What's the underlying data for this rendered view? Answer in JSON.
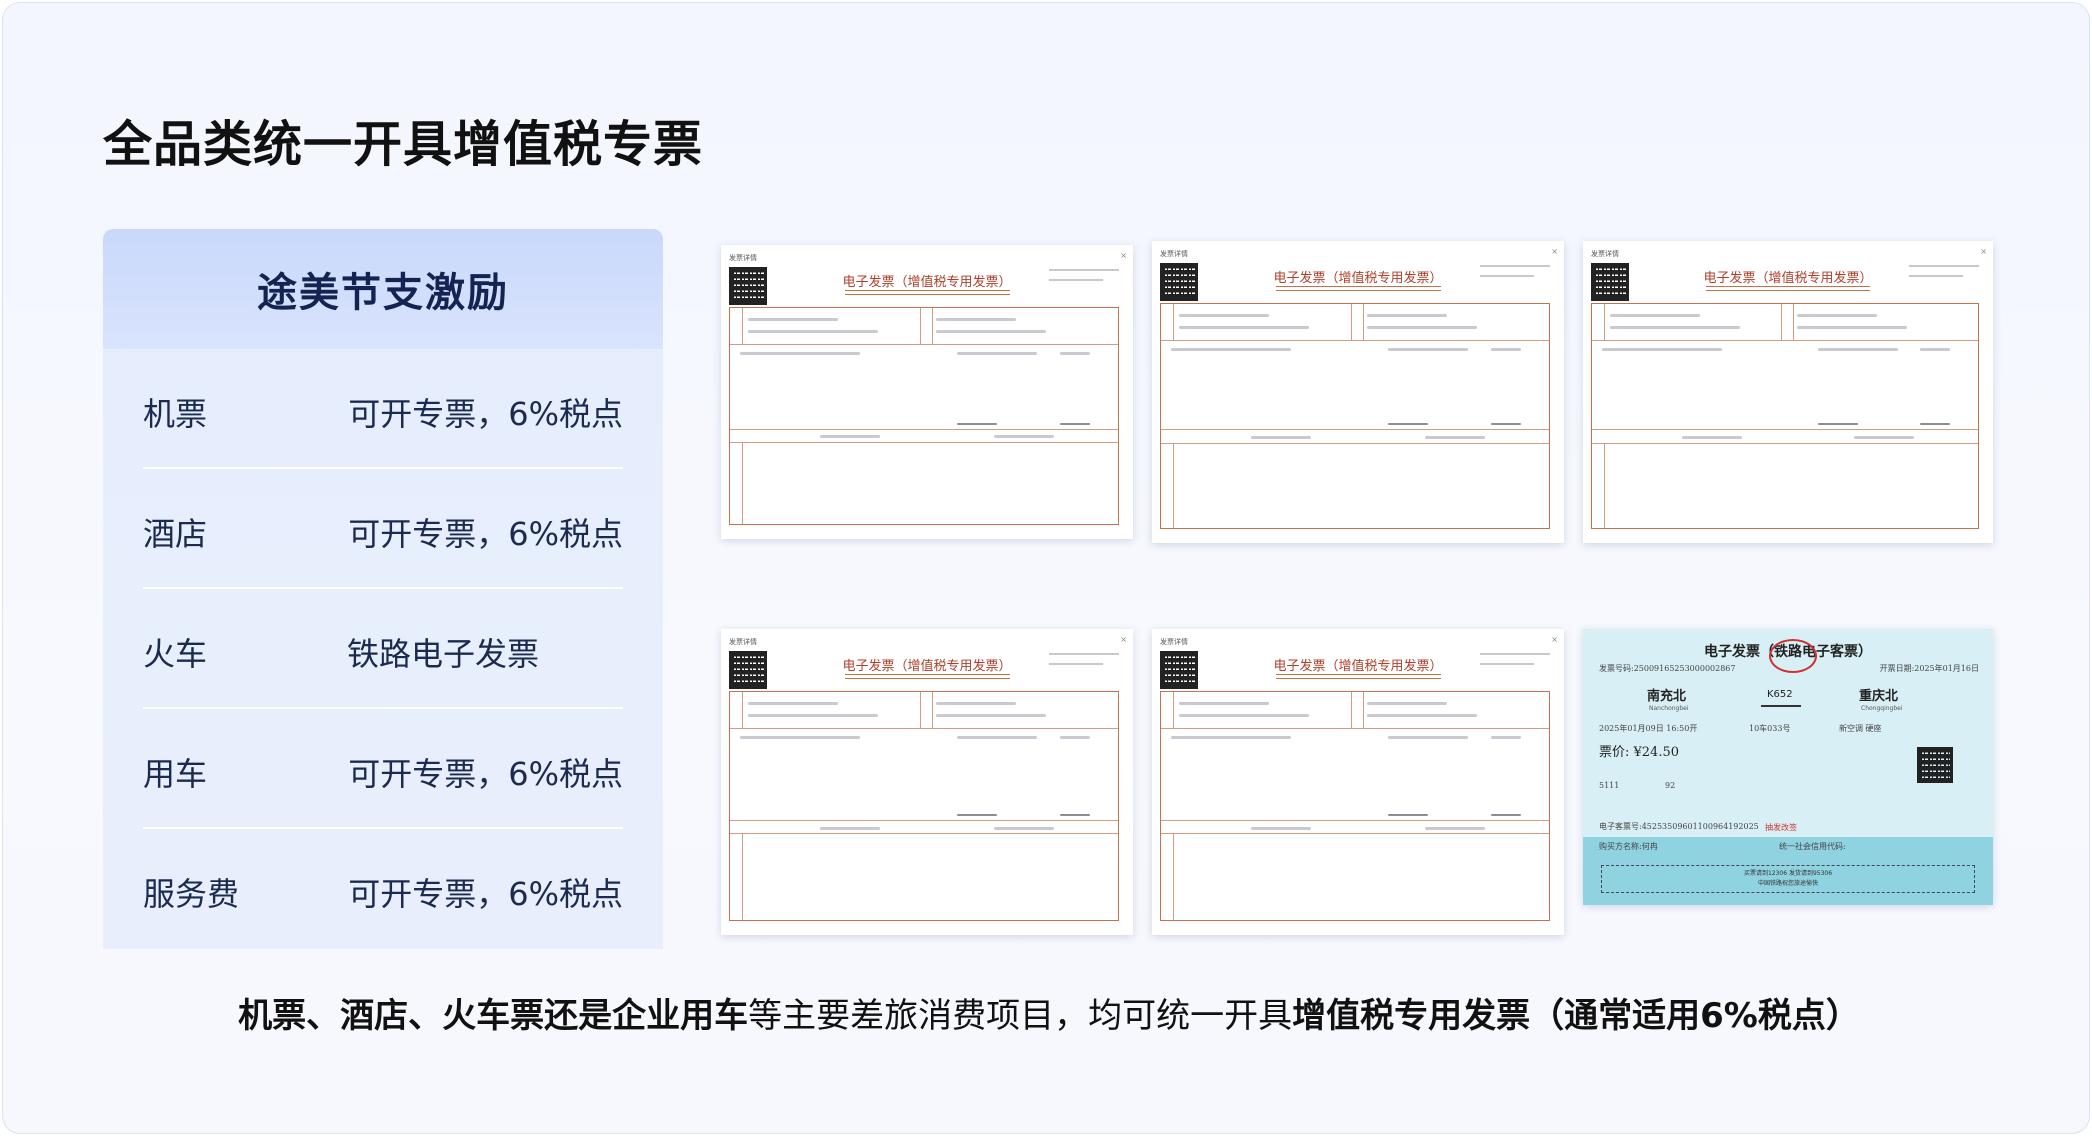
{
  "title": "全品类统一开具增值税专票",
  "incentive": {
    "heading": "途美节支激励",
    "rows": [
      {
        "category": "机票",
        "value": "可开专票，6%税点"
      },
      {
        "category": "酒店",
        "value": "可开专票，6%税点"
      },
      {
        "category": "火车",
        "value": "铁路电子发票"
      },
      {
        "category": "用车",
        "value": "可开专票，6%税点"
      },
      {
        "category": "服务费",
        "value": "可开专票，6%税点"
      }
    ]
  },
  "invoices": {
    "header_label": "发票详情",
    "close_glyph": "×",
    "vat_title": "电子发票（增值税专用发票）",
    "rail_ticket": {
      "title": "电子发票（铁路电子客票）",
      "invoice_no": "发票号码:25009165253000002867",
      "issue_date": "开票日期:2025年01月16日",
      "from_station": "南充北",
      "from_pinyin": "Nanchongbei",
      "train": "K652",
      "to_station": "重庆北",
      "to_pinyin": "Chongqingbei",
      "depart": "2025年01月09日  16:50开",
      "seat": "10车033号",
      "seat_class": "新空调 硬座",
      "price": "票价: ¥24.50",
      "passenger_label": "5111",
      "passenger_field": "92",
      "eticket_no": "电子客票号:45253509601100964192025",
      "buyer_label": "购买方名称:何冉",
      "buyer_tax": "统一社会信用代码:",
      "foot_line1": "买票请到12306 发货请到95306",
      "foot_line2": "中国铁路祝您旅途愉快",
      "red_note": "抽发改签"
    }
  },
  "caption": {
    "part1": "机票、酒店、火车票还是企业用车",
    "part2": "等主要差旅消费项目，均可统一开具",
    "part3": "增值税专用发票（通常适用6%税点）"
  }
}
